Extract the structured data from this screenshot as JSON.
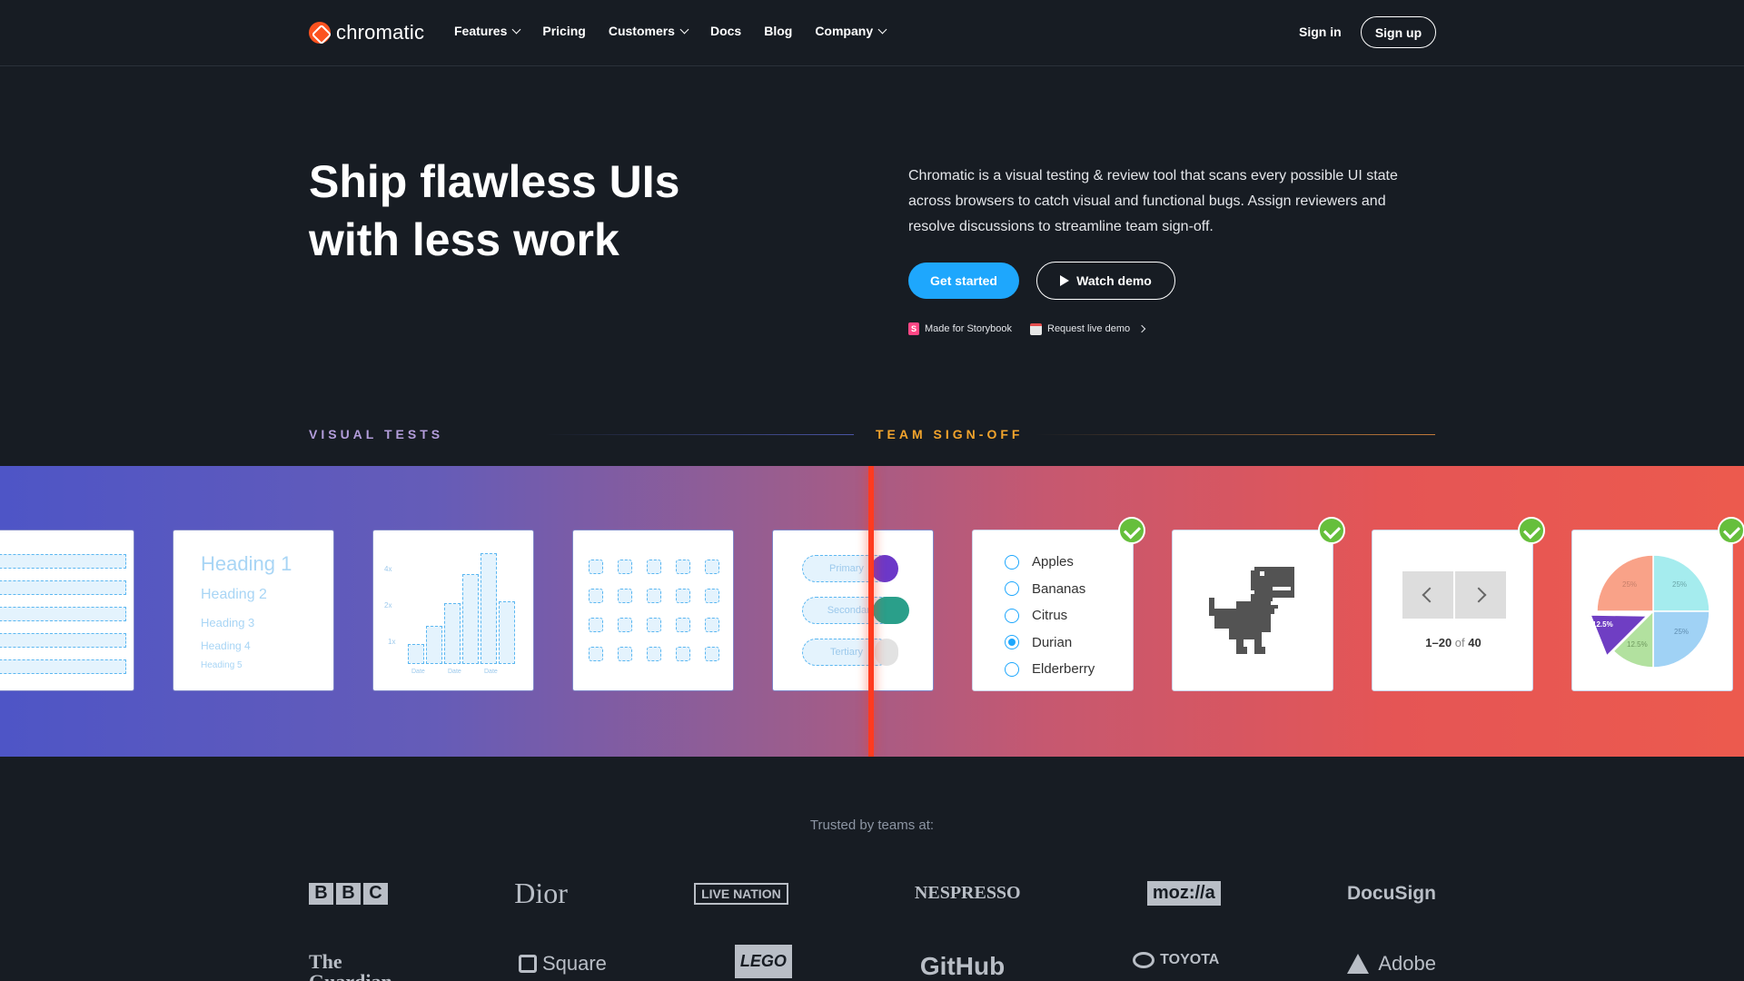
{
  "nav": {
    "brand": "chromatic",
    "links": [
      {
        "label": "Features",
        "dropdown": true
      },
      {
        "label": "Pricing",
        "dropdown": false
      },
      {
        "label": "Customers",
        "dropdown": true
      },
      {
        "label": "Docs",
        "dropdown": false
      },
      {
        "label": "Blog",
        "dropdown": false
      },
      {
        "label": "Company",
        "dropdown": true
      }
    ],
    "sign_in": "Sign in",
    "sign_up": "Sign up"
  },
  "hero": {
    "title_line1": "Ship flawless UIs",
    "title_line2": "with less work",
    "description": "Chromatic is a visual testing & review tool that scans every possible UI state across browsers to catch visual and functional bugs. Assign reviewers and resolve discussions to streamline team sign-off.",
    "primary_cta": "Get started",
    "secondary_cta": "Watch demo",
    "storybook_link": "Made for Storybook",
    "demo_link": "Request live demo"
  },
  "sections": {
    "visual_tests": "VISUAL TESTS",
    "team_signoff": "TEAM SIGN-OFF"
  },
  "showcase": {
    "heading_card": [
      "Heading 1",
      "Heading 2",
      "Heading 3",
      "Heading 4",
      "Heading 5"
    ],
    "bar_card_labels": [
      "4x",
      "2x",
      "1x",
      "Date",
      "Date",
      "Date"
    ],
    "button_card": [
      "Primary",
      "Secondary",
      "Tertiary"
    ],
    "radio_options": [
      {
        "label": "Apples",
        "selected": false
      },
      {
        "label": "Bananas",
        "selected": false
      },
      {
        "label": "Citrus",
        "selected": false
      },
      {
        "label": "Durian",
        "selected": true
      },
      {
        "label": "Elderberry",
        "selected": false
      }
    ],
    "pagination": {
      "range": "1–20",
      "of": "of",
      "total": "40"
    },
    "pie_labels": [
      "25%",
      "25%",
      "25%",
      "12.5%",
      "12.5%"
    ]
  },
  "trusted": {
    "label": "Trusted by teams at:",
    "row1": [
      "BBC",
      "Dior",
      "LIVE NATION",
      "NESPRESSO",
      "moz://a",
      "DocuSign"
    ],
    "row2": [
      "The Guardian",
      "Square",
      "LEGO",
      "GitHub",
      "TOYOTA",
      "Adobe"
    ]
  },
  "colors": {
    "background": "#171c23",
    "primary_button": "#1ea7fd",
    "visual_tests_label": "#b39ddb",
    "team_signoff_label": "#f2a42c",
    "check": "#66bf3c",
    "brand": "#fc521f"
  }
}
